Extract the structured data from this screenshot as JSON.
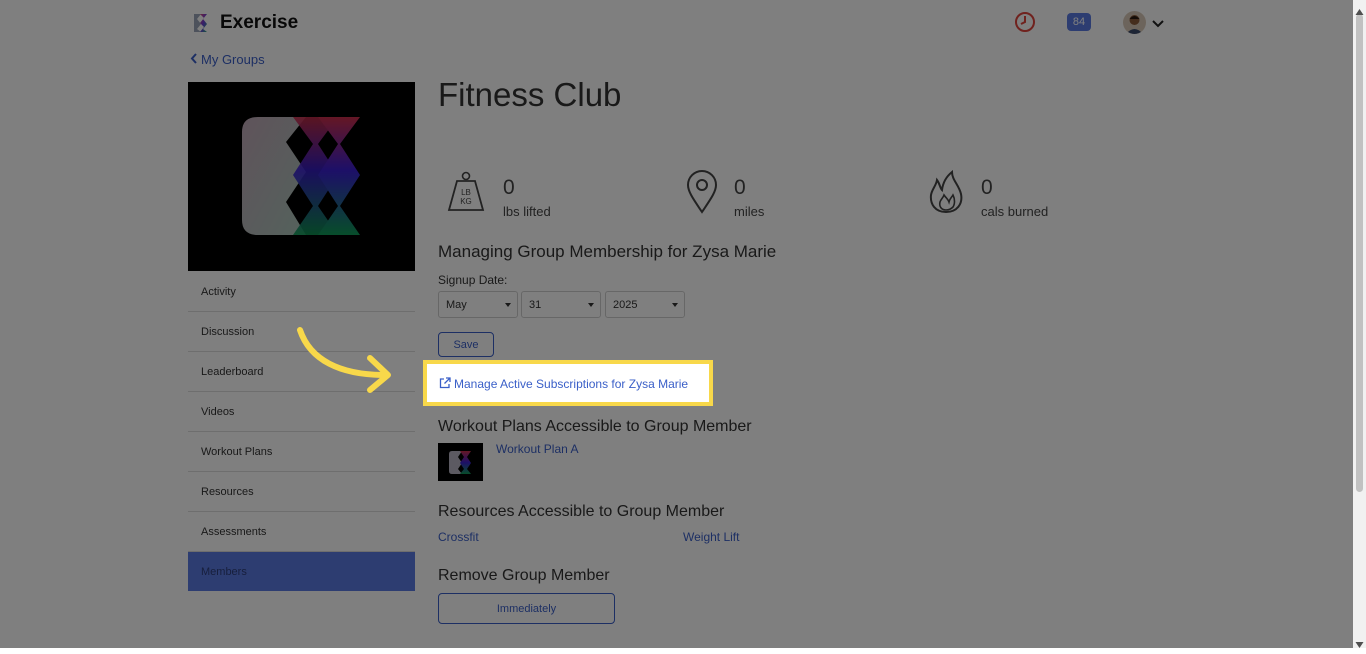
{
  "header": {
    "app_title": "Exercise",
    "notification_count": "84"
  },
  "nav": {
    "back_label": "My Groups",
    "items": [
      "Activity",
      "Discussion",
      "Leaderboard",
      "Videos",
      "Workout Plans",
      "Resources",
      "Assessments",
      "Members"
    ],
    "active_index": 7
  },
  "group": {
    "title": "Fitness Club"
  },
  "stats": [
    {
      "icon": "weight-icon",
      "value": "0",
      "label": "lbs lifted",
      "icon_text": [
        "LB",
        "KG"
      ]
    },
    {
      "icon": "map-pin-icon",
      "value": "0",
      "label": "miles"
    },
    {
      "icon": "flame-icon",
      "value": "0",
      "label": "cals burned"
    }
  ],
  "membership": {
    "heading": "Managing Group Membership for Zysa Marie",
    "signup_label": "Signup Date:",
    "month": "May",
    "day": "31",
    "year": "2025",
    "save_label": "Save",
    "manage_link": "Manage Active Subscriptions for Zysa Marie"
  },
  "plans": {
    "heading": "Workout Plans Accessible to Group Member",
    "items": [
      "Workout Plan A"
    ]
  },
  "resources": {
    "heading": "Resources Accessible to Group Member",
    "items": [
      "Crossfit",
      "Weight Lift"
    ]
  },
  "remove": {
    "heading": "Remove Group Member",
    "immediately_label": "Immediately"
  },
  "colors": {
    "accent": "#3a5fc8",
    "active_nav": "#5b7be3",
    "highlight": "#f8d84a"
  }
}
